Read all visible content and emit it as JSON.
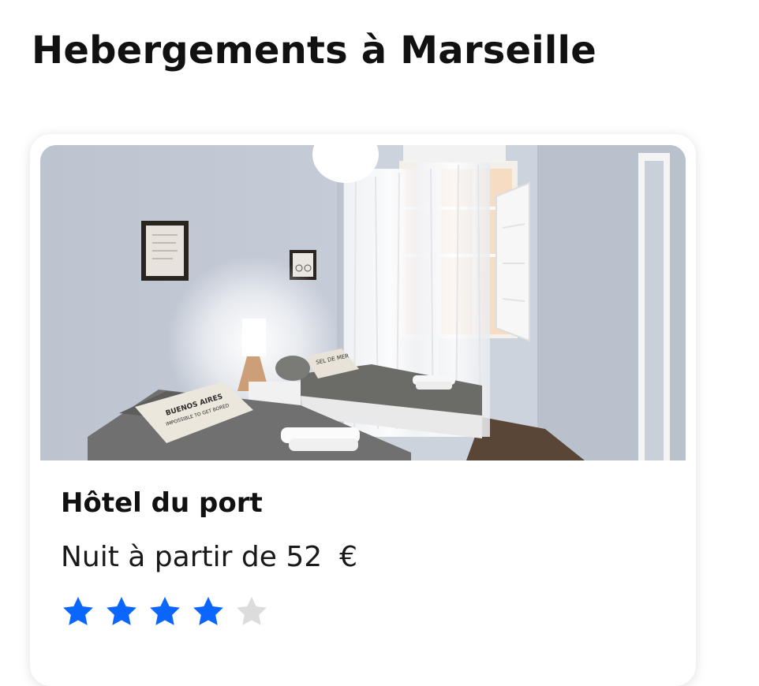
{
  "page": {
    "title": "Hebergements à Marseille"
  },
  "listing": {
    "photo": "hotel-room-photo",
    "name": "Hôtel du port",
    "price_prefix": "Nuit à partir de",
    "price_value": "52",
    "currency": "€",
    "rating": 4,
    "rating_max": 5,
    "photo_texts": {
      "pillow_front_line1": "BUENOS AIRES",
      "pillow_front_line2": "IMPOSSIBLE TO GET BORED",
      "pillow_back": "SEL DE MER"
    }
  },
  "colors": {
    "star_filled": "#0a66ff",
    "star_empty": "#dcdcdc",
    "wall": "#c3cad6"
  }
}
